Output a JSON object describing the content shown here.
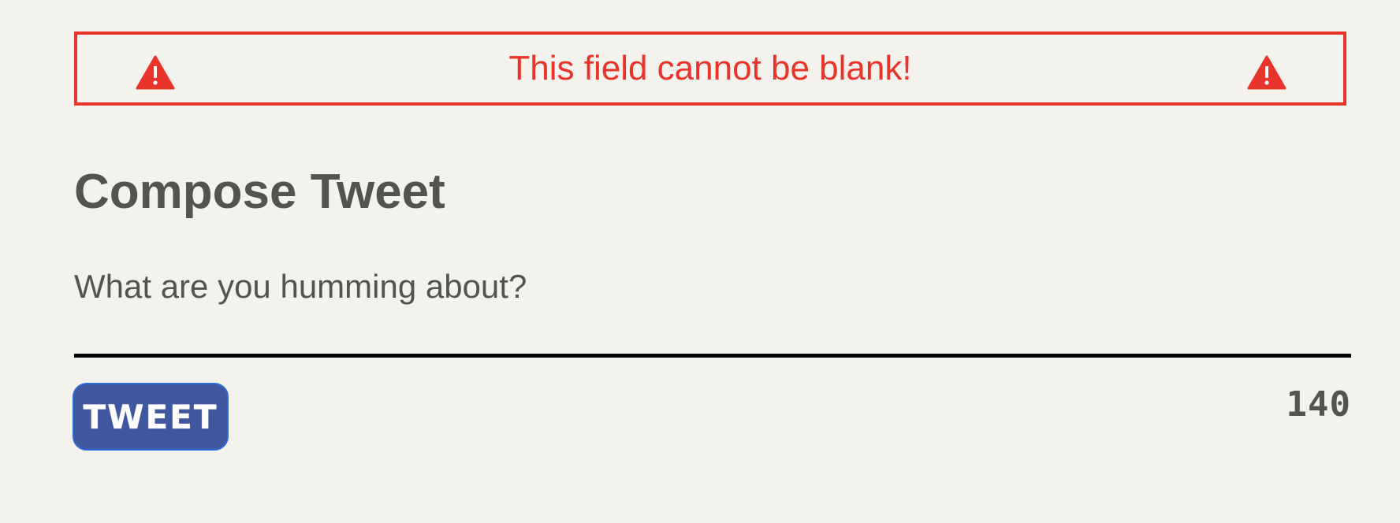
{
  "error": {
    "message": "This field cannot be blank!",
    "icon_left": "warning-triangle-icon",
    "icon_right": "warning-triangle-icon",
    "color": "#e8342a"
  },
  "compose": {
    "title": "Compose Tweet",
    "placeholder": "What are you humming about?",
    "value": ""
  },
  "actions": {
    "tweet_label": "TWEET",
    "button_color": "#40569e"
  },
  "counter": {
    "remaining": "140"
  },
  "theme": {
    "background": "#f4f2ed",
    "text": "#54534e"
  }
}
